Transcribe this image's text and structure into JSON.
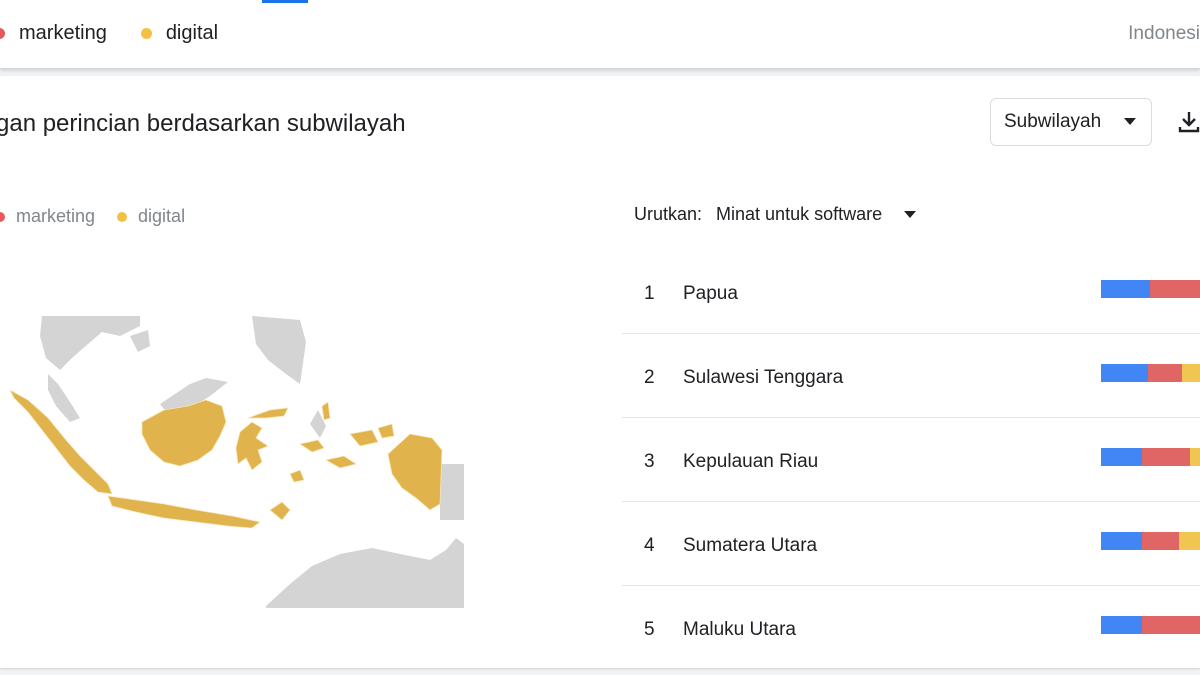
{
  "colors": {
    "blue": "#4285f4",
    "red": "#e06666",
    "yellow": "#f1c551",
    "map_region": "#e0b34c",
    "map_land": "#d4d4d4"
  },
  "topbar": {
    "legend": [
      {
        "label": "marketing",
        "color": "#e8575a"
      },
      {
        "label": "digital",
        "color": "#f2c143"
      }
    ],
    "region": "Indonesi"
  },
  "card": {
    "title": "gan perincian berdasarkan subwilayah",
    "select_label": "Subwilayah",
    "download_icon": "download-icon"
  },
  "map_legend": [
    {
      "label": "marketing",
      "color": "#e8575a"
    },
    {
      "label": "digital",
      "color": "#f2c143"
    }
  ],
  "sort": {
    "label": "Urutkan:",
    "value": "Minat untuk software"
  },
  "regions": [
    {
      "rank": "1",
      "name": "Papua",
      "share": [
        0.49,
        0.51,
        0.0
      ]
    },
    {
      "rank": "2",
      "name": "Sulawesi Tenggara",
      "share": [
        0.47,
        0.35,
        0.18
      ]
    },
    {
      "rank": "3",
      "name": "Kepulauan Riau",
      "share": [
        0.41,
        0.49,
        0.1
      ]
    },
    {
      "rank": "4",
      "name": "Sumatera Utara",
      "share": [
        0.41,
        0.38,
        0.21
      ]
    },
    {
      "rank": "5",
      "name": "Maluku Utara",
      "share": [
        0.41,
        0.59,
        0.0
      ]
    }
  ]
}
